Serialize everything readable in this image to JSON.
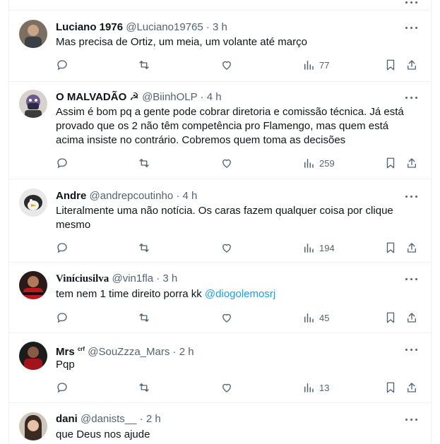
{
  "tweets": [
    {
      "name": "Luciano 1976",
      "handle": "@Luciano19765",
      "time": "3 h",
      "text": "Mas precisa de Ortiz, um meia, um volante até março",
      "views": "77"
    },
    {
      "name": "O MALVADÃO ☭",
      "handle": "@BiinhOLP",
      "time": "4 h",
      "text": "Assim é bom pq a gente pode cobrar diretoria e comissão técnica. Já está provado que os 2 não têm competência pro Flamengo, mas quem está acima insiste no contrário. Cobremos quem toma as decisões",
      "views": "259"
    },
    {
      "name": "Andre",
      "handle": "@andrepcoutinho",
      "time": "4 h",
      "text": "Literalmente uma não notícia. Os caras fazem qualquer coisa por clique mesmo",
      "views": "194"
    },
    {
      "name": "Viníciusilva",
      "handle": "@vin1fla",
      "time": "3 h",
      "text": "tem nem 1 time direito porra kk",
      "mention": "@diogolemosrj",
      "views": "45"
    },
    {
      "name": "Mrs",
      "name_badge": "crf",
      "handle": "@SouZzza_Mars",
      "time": "2 h",
      "text": "Pqp",
      "views": "13"
    },
    {
      "name": "dani",
      "handle": "@danists__",
      "time": "2 h",
      "text": "que Deus nos ajude"
    }
  ],
  "separator": " · ",
  "icons": [
    "more-icon",
    "reply-icon",
    "retweet-icon",
    "like-icon",
    "views-icon",
    "bookmark-icon",
    "share-icon"
  ],
  "colors": {
    "text": "#0f1419",
    "meta": "#536471",
    "link": "#1d9bf0",
    "border": "#eff3f4"
  }
}
